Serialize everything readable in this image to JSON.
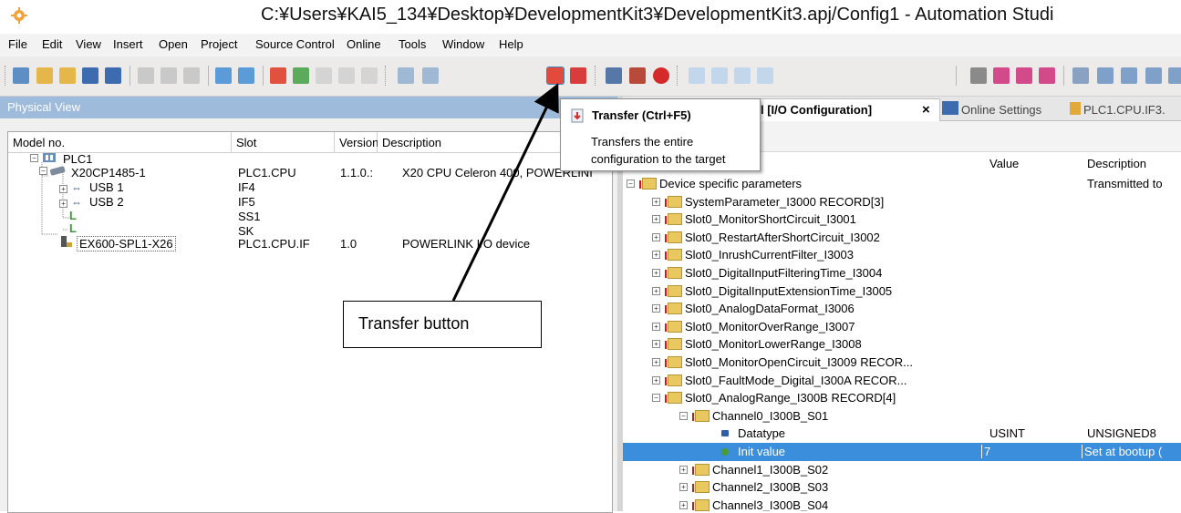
{
  "window": {
    "title": "C:¥Users¥KAI5_134¥Desktop¥DevelopmentKit3¥DevelopmentKit3.apj/Config1 - Automation Studi"
  },
  "menu": [
    "File",
    "Edit",
    "View",
    "Insert",
    "Open",
    "Project",
    "Source Control",
    "Online",
    "Tools",
    "Window",
    "Help"
  ],
  "physical_view": {
    "header": "Physical View",
    "columns": [
      "Model no.",
      "Slot",
      "Version",
      "Description"
    ],
    "rows": [
      {
        "model": "PLC1",
        "slot": "",
        "version": "",
        "description": ""
      },
      {
        "model": "X20CP1485-1",
        "slot": "PLC1.CPU",
        "version": "1.1.0.:",
        "description": "X20 CPU Celeron 400, POWERLINI"
      },
      {
        "model": "USB 1",
        "slot": "IF4",
        "version": "",
        "description": ""
      },
      {
        "model": "USB 2",
        "slot": "IF5",
        "version": "",
        "description": ""
      },
      {
        "model": "",
        "slot": "SS1",
        "version": "",
        "description": ""
      },
      {
        "model": "",
        "slot": "SK",
        "version": "",
        "description": ""
      },
      {
        "model": "EX600-SPL1-X26",
        "slot": "PLC1.CPU.IF",
        "version": "1.0",
        "description": "POWERLINK I/O device"
      }
    ]
  },
  "tabs": [
    {
      "label": "l [I/O Configuration]",
      "close": "×",
      "active": true
    },
    {
      "label": "Online Settings",
      "active": false
    },
    {
      "label": "PLC1.CPU.IF3.",
      "active": false
    }
  ],
  "config_grid": {
    "headers": {
      "value": "Value",
      "description": "Description"
    },
    "rows": [
      {
        "name": "Device specific parameters",
        "value": "",
        "desc": "Transmitted to",
        "level": 0,
        "expanded": true
      },
      {
        "name": "SystemParameter_I3000 RECORD[3]",
        "value": "",
        "desc": "",
        "level": 1
      },
      {
        "name": "Slot0_MonitorShortCircuit_I3001",
        "value": "",
        "desc": "",
        "level": 1
      },
      {
        "name": "Slot0_RestartAfterShortCircuit_I3002",
        "value": "",
        "desc": "",
        "level": 1
      },
      {
        "name": "Slot0_InrushCurrentFilter_I3003",
        "value": "",
        "desc": "",
        "level": 1
      },
      {
        "name": "Slot0_DigitalInputFilteringTime_I3004",
        "value": "",
        "desc": "",
        "level": 1
      },
      {
        "name": "Slot0_DigitalInputExtensionTime_I3005",
        "value": "",
        "desc": "",
        "level": 1
      },
      {
        "name": "Slot0_AnalogDataFormat_I3006",
        "value": "",
        "desc": "",
        "level": 1
      },
      {
        "name": "Slot0_MonitorOverRange_I3007",
        "value": "",
        "desc": "",
        "level": 1
      },
      {
        "name": "Slot0_MonitorLowerRange_I3008",
        "value": "",
        "desc": "",
        "level": 1
      },
      {
        "name": "Slot0_MonitorOpenCircuit_I3009 RECOR...",
        "value": "",
        "desc": "",
        "level": 1
      },
      {
        "name": "Slot0_FaultMode_Digital_I300A RECOR...",
        "value": "",
        "desc": "",
        "level": 1
      },
      {
        "name": "Slot0_AnalogRange_I300B RECORD[4]",
        "value": "",
        "desc": "",
        "level": 1,
        "expanded": true
      },
      {
        "name": "Channel0_I300B_S01",
        "value": "",
        "desc": "",
        "level": 2,
        "expanded": true
      },
      {
        "name": "Datatype",
        "value": "USINT",
        "desc": "UNSIGNED8",
        "level": 3
      },
      {
        "name": "Init value",
        "value": "7",
        "desc": "Set at bootup (",
        "level": 3,
        "selected": true
      },
      {
        "name": "Channel1_I300B_S02",
        "value": "",
        "desc": "",
        "level": 2
      },
      {
        "name": "Channel2_I300B_S03",
        "value": "",
        "desc": "",
        "level": 2
      },
      {
        "name": "Channel3_I300B_S04",
        "value": "",
        "desc": "",
        "level": 2
      }
    ]
  },
  "tooltip": {
    "title": "Transfer  (Ctrl+F5)",
    "description": "Transfers the entire configuration to the target"
  },
  "callout": {
    "label": "Transfer button"
  },
  "colors": {
    "panel_header": "#9ebbdc",
    "selection": "#3b8edb",
    "toolbar": "#ecebe9"
  }
}
